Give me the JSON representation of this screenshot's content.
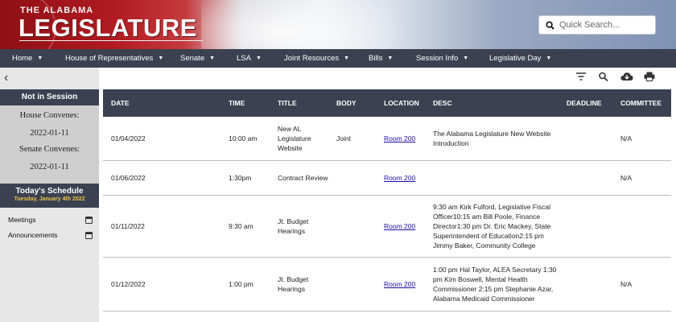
{
  "header": {
    "logo_small": "THE ALABAMA",
    "logo_big": "LEGISLATURE",
    "search_placeholder": "Quick Search..."
  },
  "nav": {
    "items": [
      {
        "label": "Home"
      },
      {
        "label": "House of Representatives"
      },
      {
        "label": "Senate"
      },
      {
        "label": "LSA"
      },
      {
        "label": "Joint Resources"
      },
      {
        "label": "Bills"
      },
      {
        "label": "Session Info"
      },
      {
        "label": "Legislative Day"
      }
    ],
    "caret": "▼"
  },
  "sidebar": {
    "back": "‹",
    "status": "Not in Session",
    "house_label": "House Convenes:",
    "house_date": "2022-01-11",
    "senate_label": "Senate Convenes:",
    "senate_date": "2022-01-11",
    "schedule_title": "Today's Schedule",
    "schedule_date": "Tuesday, January 4th 2022",
    "links": [
      {
        "label": "Meetings"
      },
      {
        "label": "Announcements"
      }
    ]
  },
  "table": {
    "headers": [
      "DATE",
      "TIME",
      "TITLE",
      "BODY",
      "LOCATION",
      "DESC",
      "DEADLINE",
      "COMMITTEE"
    ],
    "rows": [
      {
        "date": "01/04/2022",
        "time": "10:00 am",
        "title": "New AL Legislature Website",
        "body": "Joint",
        "location": "Room 200",
        "desc": "The Alabama Legislature New Website Introduction",
        "deadline": "",
        "committee": "N/A"
      },
      {
        "date": "01/06/2022",
        "time": "1:30pm",
        "title": "Contract Review",
        "body": "",
        "location": "Room 200",
        "desc": "",
        "deadline": "",
        "committee": "N/A"
      },
      {
        "date": "01/11/2022",
        "time": "9:30 am",
        "title": "Jt. Budget Hearings",
        "body": "",
        "location": "Room 200",
        "desc": "9:30 am Kirk Fulford, Legislative Fiscal Officer10:15 am Bill Poole, Finance Director1:30 pm Dr. Eric Mackey, State Superintendent of Education2:15 pm Jimmy Baker, Community College",
        "deadline": "",
        "committee": ""
      },
      {
        "date": "01/12/2022",
        "time": "1:00 pm",
        "title": "Jt. Budget Hearings",
        "body": "",
        "location": "Room 200",
        "desc": "1:00 pm Hal Taylor, ALEA Secretary 1:30 pm Kim Boswell, Mental Health Commissioner 2:15 pm Stephanie Azar, Alabama Medicaid Commissioner",
        "deadline": "",
        "committee": "N/A"
      }
    ]
  },
  "colors": {
    "nav_bg": "#3b4150",
    "sidebar_bg": "#e7e7e7",
    "accent_gold": "#e7c24a",
    "link": "#1a0dab"
  },
  "icons": [
    "search-icon",
    "filter-icon",
    "cloud-download-icon",
    "print-icon",
    "calendar-icon",
    "chevron-left-icon"
  ]
}
